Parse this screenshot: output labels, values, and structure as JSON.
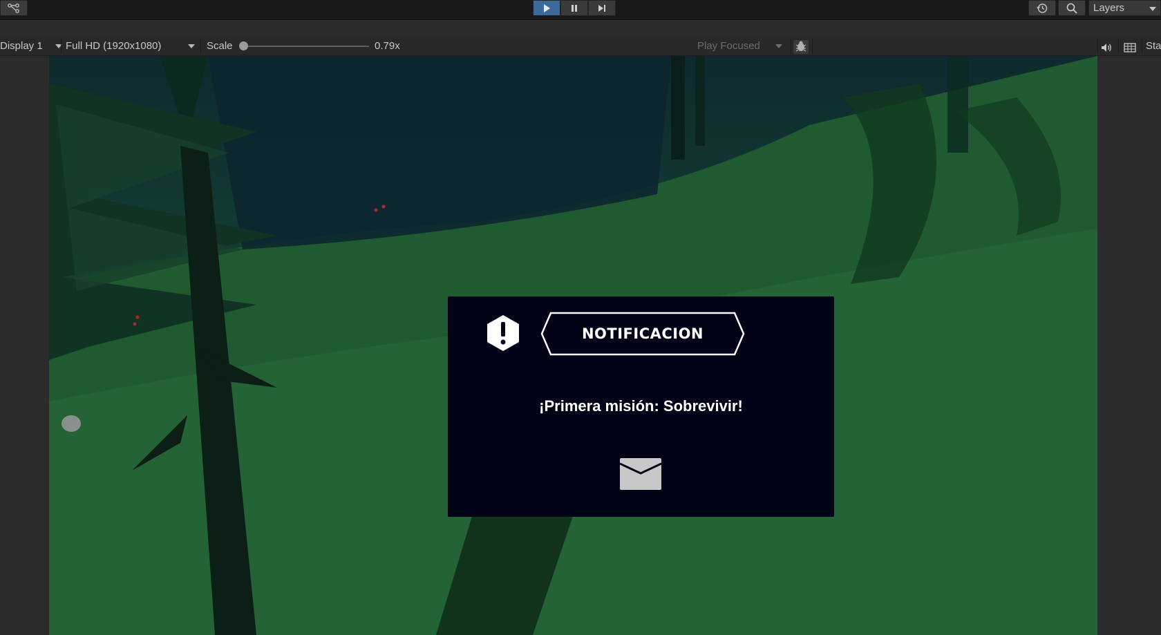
{
  "toolbar": {
    "left_icon": "collab-graph-icon",
    "play_icons": [
      "play-icon",
      "pause-icon",
      "step-icon"
    ],
    "history_icon": "history-icon",
    "search_icon": "search-icon",
    "layers_label": "Layers"
  },
  "game_toolbar": {
    "display_label": "Display 1",
    "resolution_label": "Full HD (1920x1080)",
    "scale_label": "Scale",
    "scale_value_text": "0.79x",
    "play_focused_label": "Play Focused",
    "bug_icon": "bug-icon",
    "audio_icon": "audio-icon",
    "grid_icon": "grid-icon",
    "stats_label": "Sta"
  },
  "notification": {
    "title": "NOTIFICACION",
    "message": "¡Primera misión: Sobrevivir!",
    "alert_icon": "alert-hexagon-icon",
    "envelope_icon": "envelope-icon"
  },
  "colors": {
    "play_active": "#3d6a9c",
    "panel_bg": "#030318",
    "text_white": "#ffffff",
    "editor_bg": "#2b2b2b"
  }
}
